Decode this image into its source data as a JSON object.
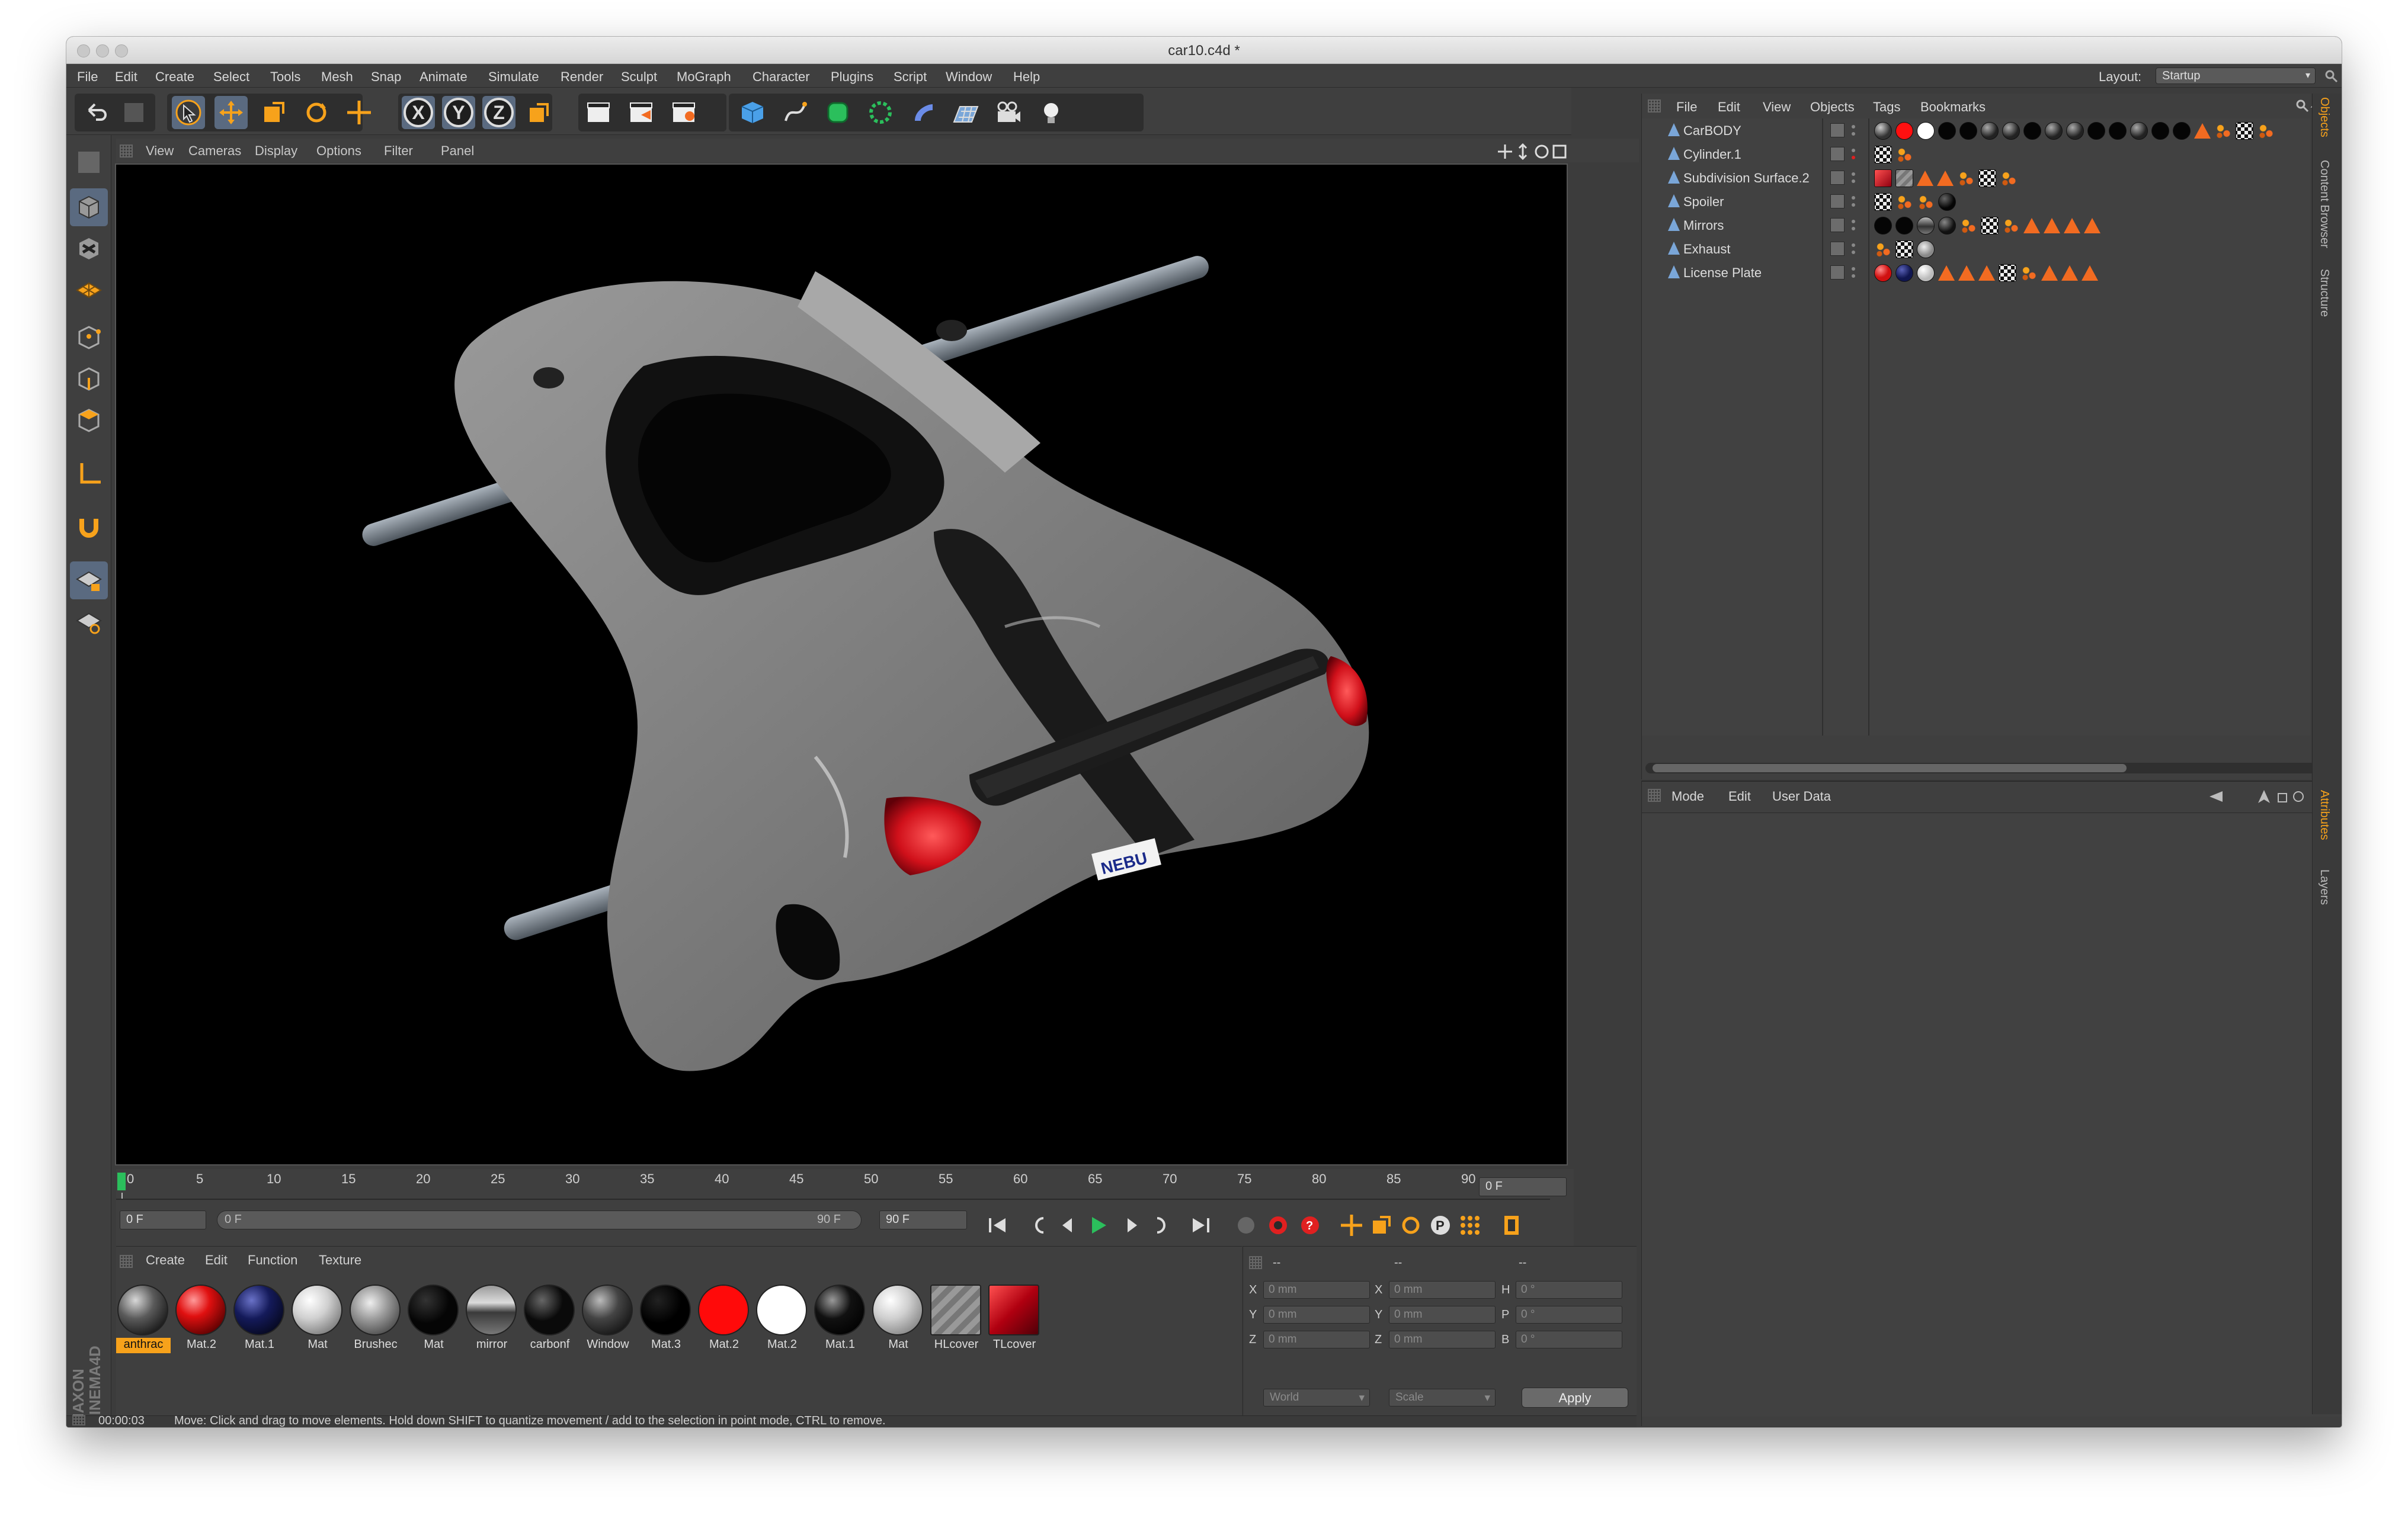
{
  "window": {
    "title": "car10.c4d *"
  },
  "menubar": {
    "items": [
      "File",
      "Edit",
      "Create",
      "Select",
      "Tools",
      "Mesh",
      "Snap",
      "Animate",
      "Simulate",
      "Render",
      "Sculpt",
      "MoGraph",
      "Character",
      "Plugins",
      "Script",
      "Window",
      "Help"
    ],
    "layout_label": "Layout:",
    "layout_value": "Startup"
  },
  "toolbar": {
    "axis_x": "X",
    "axis_y": "Y",
    "axis_z": "Z"
  },
  "viewport": {
    "menus": [
      "View",
      "Cameras",
      "Display",
      "Options",
      "Filter",
      "Panel"
    ],
    "plate_text": "NEBU"
  },
  "timeline": {
    "ticks": [
      "0",
      "5",
      "10",
      "15",
      "20",
      "25",
      "30",
      "35",
      "40",
      "45",
      "50",
      "55",
      "60",
      "65",
      "70",
      "75",
      "80",
      "85",
      "90"
    ],
    "current_frame_right": "0 F",
    "start_frame": "0 F",
    "range_start": "0 F",
    "range_end": "90 F",
    "end_frame": "90 F"
  },
  "materials": {
    "menus": [
      "Create",
      "Edit",
      "Function",
      "Texture"
    ],
    "items": [
      {
        "label": "anthrac",
        "type": "dark-grey",
        "selected": true
      },
      {
        "label": "Mat.2",
        "type": "red"
      },
      {
        "label": "Mat.1",
        "type": "navy"
      },
      {
        "label": "Mat",
        "type": "white"
      },
      {
        "label": "Brushec",
        "type": "brushed"
      },
      {
        "label": "Mat",
        "type": "black"
      },
      {
        "label": "mirror",
        "type": "mirror"
      },
      {
        "label": "carbonf",
        "type": "black"
      },
      {
        "label": "Window",
        "type": "dark-grey"
      },
      {
        "label": "Mat.3",
        "type": "black"
      },
      {
        "label": "Mat.2",
        "type": "flat-red"
      },
      {
        "label": "Mat.2",
        "type": "flat-white"
      },
      {
        "label": "Mat.1",
        "type": "black"
      },
      {
        "label": "Mat",
        "type": "white"
      },
      {
        "label": "HLcover",
        "type": "glass-square"
      },
      {
        "label": "TLcover",
        "type": "red-cube"
      }
    ]
  },
  "coordinates": {
    "headers": [
      "--",
      "--",
      "--"
    ],
    "rows": [
      {
        "a": "X",
        "av": "0 mm",
        "b": "X",
        "bv": "0 mm",
        "c": "H",
        "cv": "0 °"
      },
      {
        "a": "Y",
        "av": "0 mm",
        "b": "Y",
        "bv": "0 mm",
        "c": "P",
        "cv": "0 °"
      },
      {
        "a": "Z",
        "av": "0 mm",
        "b": "Z",
        "bv": "0 mm",
        "c": "B",
        "cv": "0 °"
      }
    ],
    "space_select": "World",
    "mode_select": "Scale",
    "apply_label": "Apply"
  },
  "status": {
    "time": "00:00:03",
    "message": "Move: Click and drag to move elements. Hold down SHIFT to quantize movement / add to the selection in point mode, CTRL to remove."
  },
  "object_manager": {
    "menus": [
      "File",
      "Edit",
      "View",
      "Objects",
      "Tags",
      "Bookmarks"
    ],
    "objects": [
      {
        "name": "CarBODY",
        "tags": [
          "dg",
          "red",
          "white",
          "black",
          "black",
          "dg",
          "dg",
          "black",
          "dg",
          "dg",
          "black",
          "black",
          "dg",
          "black",
          "black",
          "tri",
          "dots",
          "chk",
          "dots"
        ]
      },
      {
        "name": "Cylinder.1",
        "tags": [
          "chk",
          "dots"
        ]
      },
      {
        "name": "Subdivision Surface.2",
        "tags": [
          "redcube",
          "glass",
          "tri",
          "tri",
          "dots",
          "chk",
          "dots"
        ]
      },
      {
        "name": "Spoiler",
        "tags": [
          "chk",
          "dots",
          "dots",
          "black"
        ]
      },
      {
        "name": "Mirrors",
        "tags": [
          "black",
          "black",
          "dg",
          "black",
          "dots",
          "chk",
          "dots",
          "tri",
          "tri",
          "tri",
          "tri"
        ]
      },
      {
        "name": "Exhaust",
        "tags": [
          "dots",
          "chk",
          "glass"
        ]
      },
      {
        "name": "License Plate",
        "tags": [
          "red",
          "navy",
          "white",
          "tri",
          "tri",
          "tri",
          "chk",
          "dots",
          "tri",
          "tri",
          "tri"
        ]
      }
    ]
  },
  "attributes": {
    "menus": [
      "Mode",
      "Edit",
      "User Data"
    ]
  },
  "right_tabs": [
    "Objects",
    "Content Browser",
    "Structure",
    "Attributes",
    "Layers"
  ],
  "branding": "MAXON CINEMA 4D",
  "colors": {
    "accent": "#f7a21b",
    "ui_bg": "#3f3f3f",
    "active_tool": "#5a6a80"
  }
}
